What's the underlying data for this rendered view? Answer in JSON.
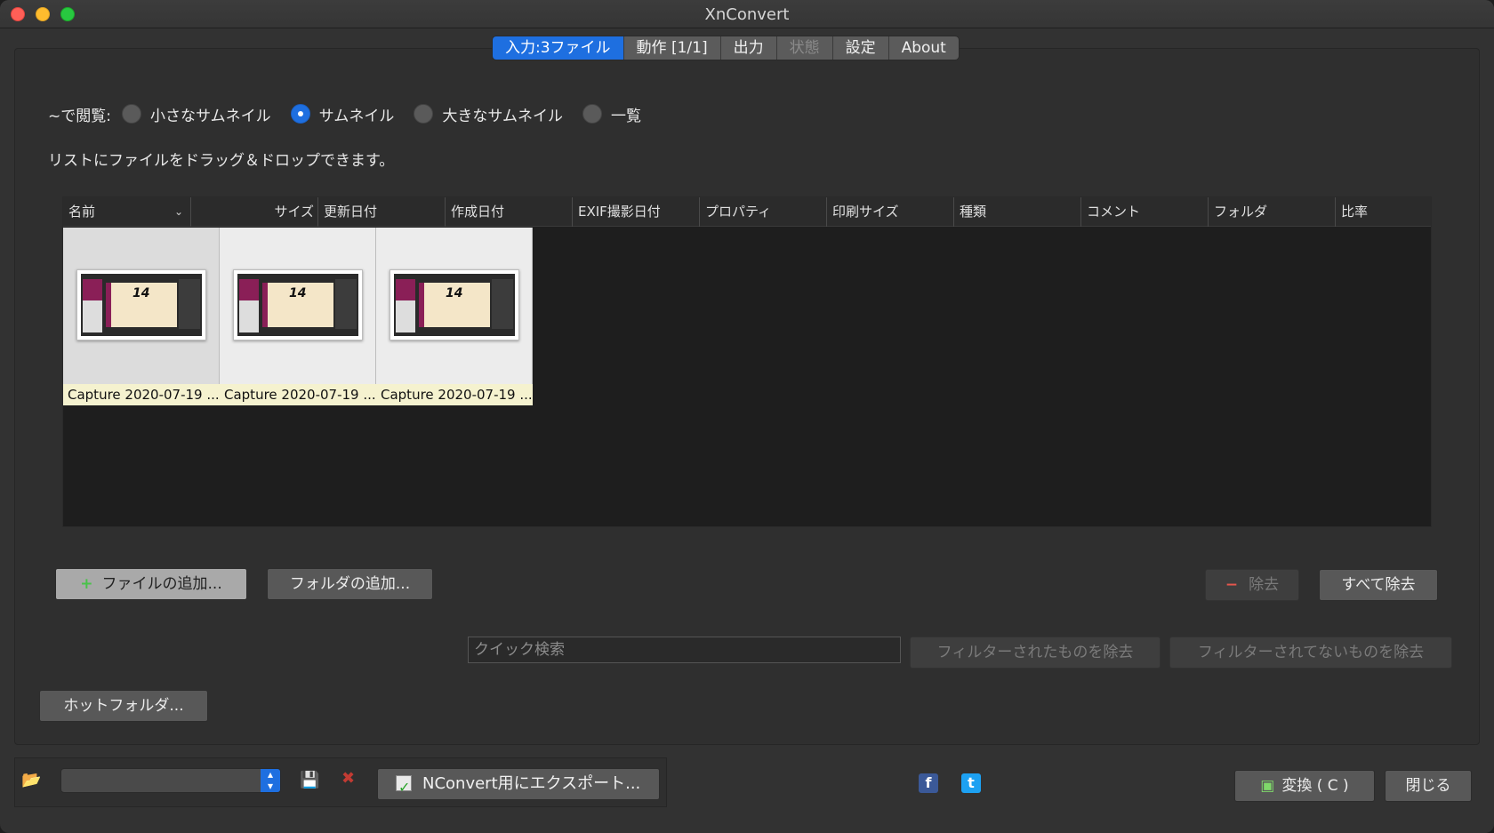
{
  "window": {
    "title": "XnConvert"
  },
  "tabs": [
    {
      "label": "入力:3ファイル",
      "active": true
    },
    {
      "label": "動作 [1/1]"
    },
    {
      "label": "出力"
    },
    {
      "label": "状態",
      "disabled": true
    },
    {
      "label": "設定"
    },
    {
      "label": "About"
    }
  ],
  "view": {
    "label": "~で閲覧:",
    "options": [
      "小さなサムネイル",
      "サムネイル",
      "大きなサムネイル",
      "一覧"
    ],
    "selected": "サムネイル"
  },
  "hint": "リストにファイルをドラッグ＆ドロップできます。",
  "columns": [
    "名前",
    "サイズ",
    "更新日付",
    "作成日付",
    "EXIF撮影日付",
    "プロパティ",
    "印刷サイズ",
    "種類",
    "コメント",
    "フォルダ",
    "比率"
  ],
  "files": [
    {
      "caption": "Capture 2020-07-19 ...",
      "thumb_text": "14"
    },
    {
      "caption": "Capture 2020-07-19 ...",
      "thumb_text": "14"
    },
    {
      "caption": "Capture 2020-07-19 ...",
      "thumb_text": "14"
    }
  ],
  "buttons": {
    "add_files": "ファイルの追加...",
    "add_folder": "フォルダの追加...",
    "remove": "除去",
    "remove_all": "すべて除去",
    "remove_filtered": "フィルターされたものを除去",
    "remove_unfiltered": "フィルターされてないものを除去",
    "hot_folder": "ホットフォルダ...",
    "export": "NConvert用にエクスポート...",
    "convert": "変換 ( C )",
    "close": "閉じる"
  },
  "search": {
    "placeholder": "クイック検索"
  },
  "icons": {
    "folder": "folder-open-icon",
    "save": "save-icon",
    "delete": "delete-icon",
    "facebook": "facebook-icon",
    "twitter": "twitter-icon"
  },
  "colors": {
    "accent": "#1e6fe0",
    "caption_bg": "#f5f2cf",
    "remove_red": "#e5564d",
    "plus_green": "#49c24a"
  }
}
